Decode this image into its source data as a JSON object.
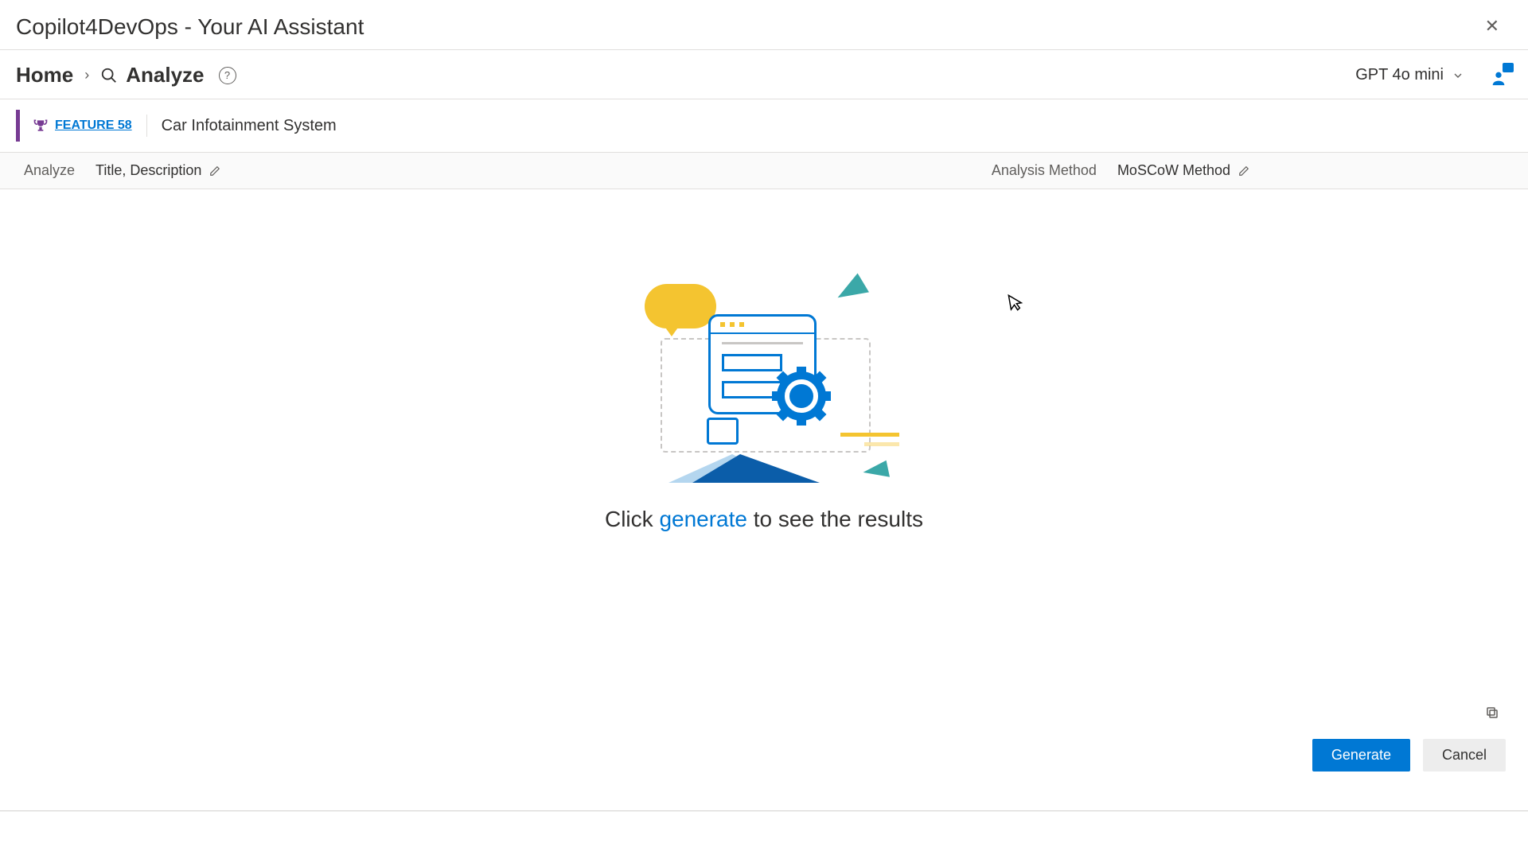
{
  "header": {
    "title": "Copilot4DevOps - Your AI Assistant"
  },
  "breadcrumb": {
    "home_label": "Home",
    "current_label": "Analyze"
  },
  "model": {
    "selected": "GPT 4o mini"
  },
  "work_item": {
    "type_label": "FEATURE 58",
    "title": "Car Infotainment System"
  },
  "params": {
    "analyze_label": "Analyze",
    "analyze_value": "Title, Description",
    "method_label": "Analysis Method",
    "method_value": "MoSCoW Method"
  },
  "empty_state": {
    "prefix": "Click ",
    "accent": "generate",
    "suffix": " to see the results"
  },
  "actions": {
    "generate": "Generate",
    "cancel": "Cancel"
  }
}
